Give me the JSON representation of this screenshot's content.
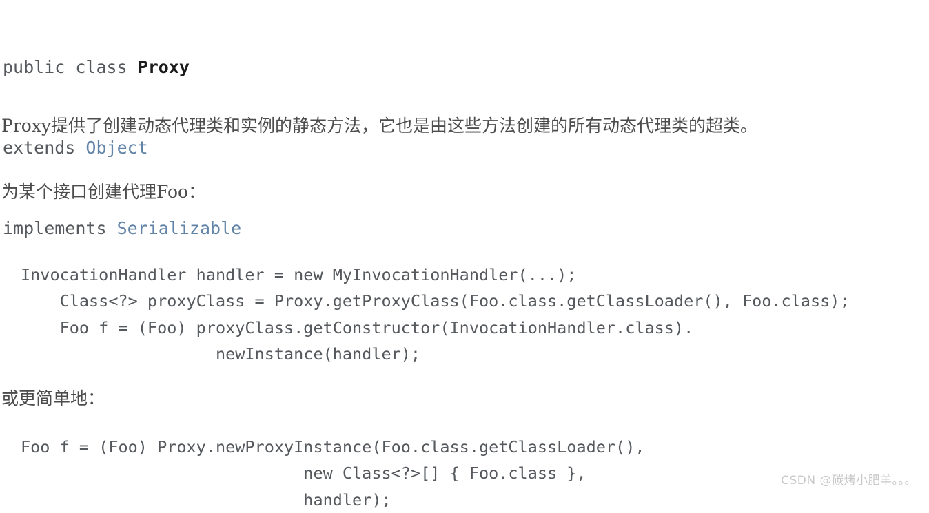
{
  "document": {
    "signature": {
      "modifier_line_prefix": "public class ",
      "class_name": "Proxy",
      "extends_keyword": "extends ",
      "extends_type": "Object",
      "implements_keyword": "implements ",
      "implements_type": "Serializable"
    },
    "paragraphs": {
      "intro": "Proxy提供了创建动态代理类和实例的静态方法，它也是由这些方法创建的所有动态代理类的超类。",
      "create_foo": "为某个接口创建代理Foo：",
      "simpler": "或更简单地："
    },
    "code_blocks": {
      "verbose": [
        "InvocationHandler handler = new MyInvocationHandler(...);",
        "    Class<?> proxyClass = Proxy.getProxyClass(Foo.class.getClassLoader(), Foo.class);",
        "    Foo f = (Foo) proxyClass.getConstructor(InvocationHandler.class).",
        "                    newInstance(handler);"
      ],
      "concise": [
        "Foo f = (Foo) Proxy.newProxyInstance(Foo.class.getClassLoader(),",
        "                             new Class<?>[] { Foo.class },",
        "                             handler);"
      ]
    },
    "watermark": "CSDN @碳烤小肥羊。。。",
    "colors": {
      "body_text": "#4c4c4c",
      "code_text": "#55595d",
      "type_link": "#6283a8",
      "class_name": "#1b1b1b",
      "watermark": "#c8c8c8",
      "background": "#ffffff"
    }
  }
}
